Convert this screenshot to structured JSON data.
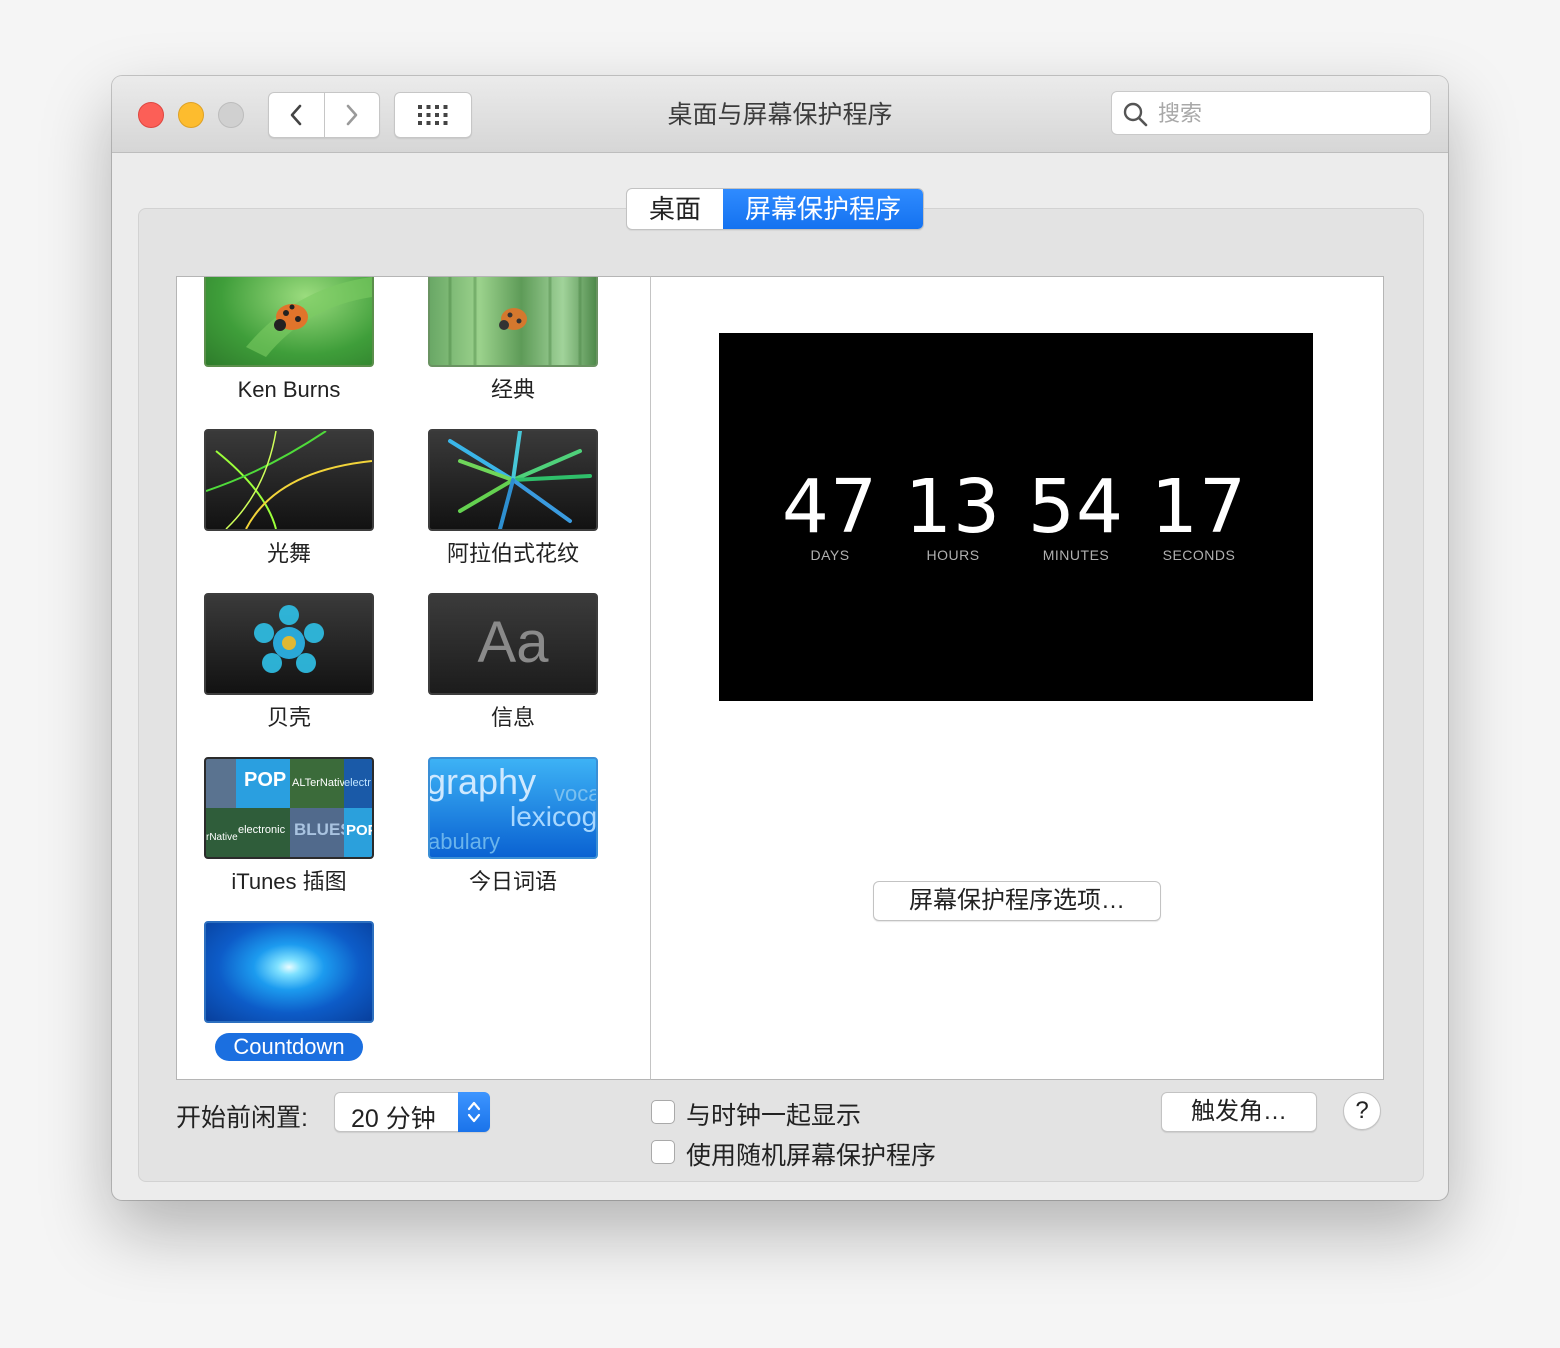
{
  "window": {
    "title": "桌面与屏幕保护程序",
    "search_placeholder": "搜索"
  },
  "tabs": [
    {
      "label": "桌面",
      "selected": false
    },
    {
      "label": "屏幕保护程序",
      "selected": true
    }
  ],
  "screensavers": [
    {
      "label": "Ken Burns",
      "selected": false
    },
    {
      "label": "经典",
      "selected": false
    },
    {
      "label": "光舞",
      "selected": false
    },
    {
      "label": "阿拉伯式花纹",
      "selected": false
    },
    {
      "label": "贝壳",
      "selected": false
    },
    {
      "label": "信息",
      "selected": false,
      "thumb_text": "Aa"
    },
    {
      "label": "iTunes 插图",
      "selected": false,
      "thumb_words": [
        "POP",
        "ALTerNative",
        "electronic",
        "BLUES",
        "electr",
        "rNative",
        "POP"
      ]
    },
    {
      "label": "今日词语",
      "selected": false,
      "thumb_words": [
        "graphy",
        "voca",
        "lexicog",
        "abulary"
      ]
    },
    {
      "label": "Countdown",
      "selected": true
    }
  ],
  "preview": {
    "units": [
      {
        "value": "47",
        "caption": "DAYS"
      },
      {
        "value": "13",
        "caption": "HOURS"
      },
      {
        "value": "54",
        "caption": "MINUTES"
      },
      {
        "value": "17",
        "caption": "SECONDS"
      }
    ],
    "options_button": "屏幕保护程序选项…"
  },
  "footer": {
    "idle_label": "开始前闲置:",
    "idle_value": "20 分钟",
    "show_clock_label": "与时钟一起显示",
    "show_clock_checked": false,
    "random_label": "使用随机屏幕保护程序",
    "random_checked": false,
    "hot_corners_label": "触发角…",
    "help_label": "?"
  },
  "colors": {
    "accent": "#1472f0",
    "close": "#fc5f57",
    "minimize": "#fdbc2e"
  }
}
